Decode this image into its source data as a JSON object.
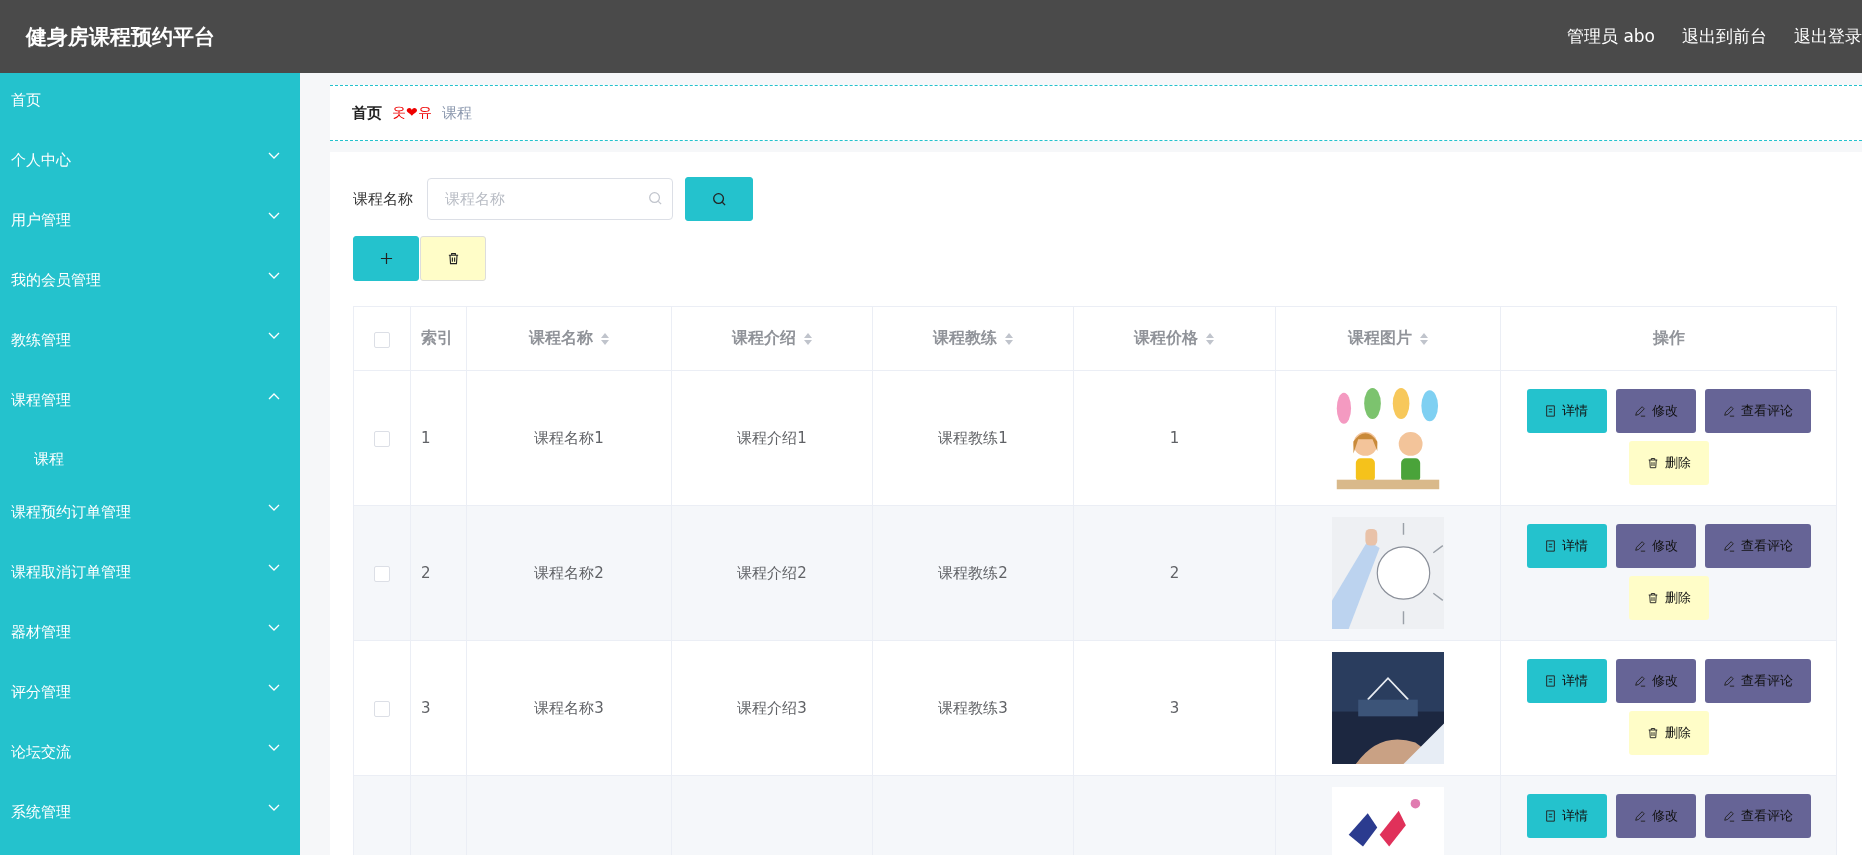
{
  "header": {
    "title": "健身房课程预约平台",
    "links": [
      "管理员 abo",
      "退出到前台",
      "退出登录"
    ]
  },
  "sidebar": {
    "items": [
      {
        "label": "首页"
      },
      {
        "label": "个人中心",
        "expanded": false
      },
      {
        "label": "用户管理",
        "expanded": false
      },
      {
        "label": "我的会员管理",
        "expanded": false
      },
      {
        "label": "教练管理",
        "expanded": false
      },
      {
        "label": "课程管理",
        "expanded": true,
        "children": [
          {
            "label": "课程"
          }
        ]
      },
      {
        "label": "课程预约订单管理",
        "expanded": false
      },
      {
        "label": "课程取消订单管理",
        "expanded": false
      },
      {
        "label": "器材管理",
        "expanded": false
      },
      {
        "label": "评分管理",
        "expanded": false
      },
      {
        "label": "论坛交流",
        "expanded": false
      },
      {
        "label": "系统管理",
        "expanded": false
      }
    ]
  },
  "breadcrumb": {
    "home": "首页",
    "separator": "옷❤유",
    "current": "课程"
  },
  "search": {
    "label": "课程名称",
    "placeholder": "课程名称"
  },
  "table": {
    "select_all_checked": false,
    "columns": [
      {
        "label": "索引",
        "sortable": false
      },
      {
        "label": "课程名称",
        "sortable": true
      },
      {
        "label": "课程介绍",
        "sortable": true
      },
      {
        "label": "课程教练",
        "sortable": true
      },
      {
        "label": "课程价格",
        "sortable": true
      },
      {
        "label": "课程图片",
        "sortable": true
      },
      {
        "label": "操作",
        "sortable": false
      }
    ],
    "rows": [
      {
        "checked": false,
        "index": "1",
        "name": "课程名称1",
        "intro": "课程介绍1",
        "coach": "课程教练1",
        "price": "1",
        "picture": {
          "kind": "picture"
        },
        "actions": [
          "详情",
          "修改",
          "查看评论",
          "删除"
        ]
      },
      {
        "checked": false,
        "index": "2",
        "name": "课程名称2",
        "intro": "课程介绍2",
        "coach": "课程教练2",
        "price": "2",
        "picture": {
          "kind": "picture"
        },
        "actions": [
          "详情",
          "修改",
          "查看评论",
          "删除"
        ]
      },
      {
        "checked": false,
        "index": "3",
        "name": "课程名称3",
        "intro": "课程介绍3",
        "coach": "课程教练3",
        "price": "3",
        "picture": {
          "kind": "picture"
        },
        "actions": [
          "详情",
          "修改",
          "查看评论",
          "删除"
        ]
      },
      {
        "picture": {
          "kind": "picture"
        },
        "actions": [
          "详情",
          "修改",
          "查看评论"
        ]
      }
    ]
  }
}
